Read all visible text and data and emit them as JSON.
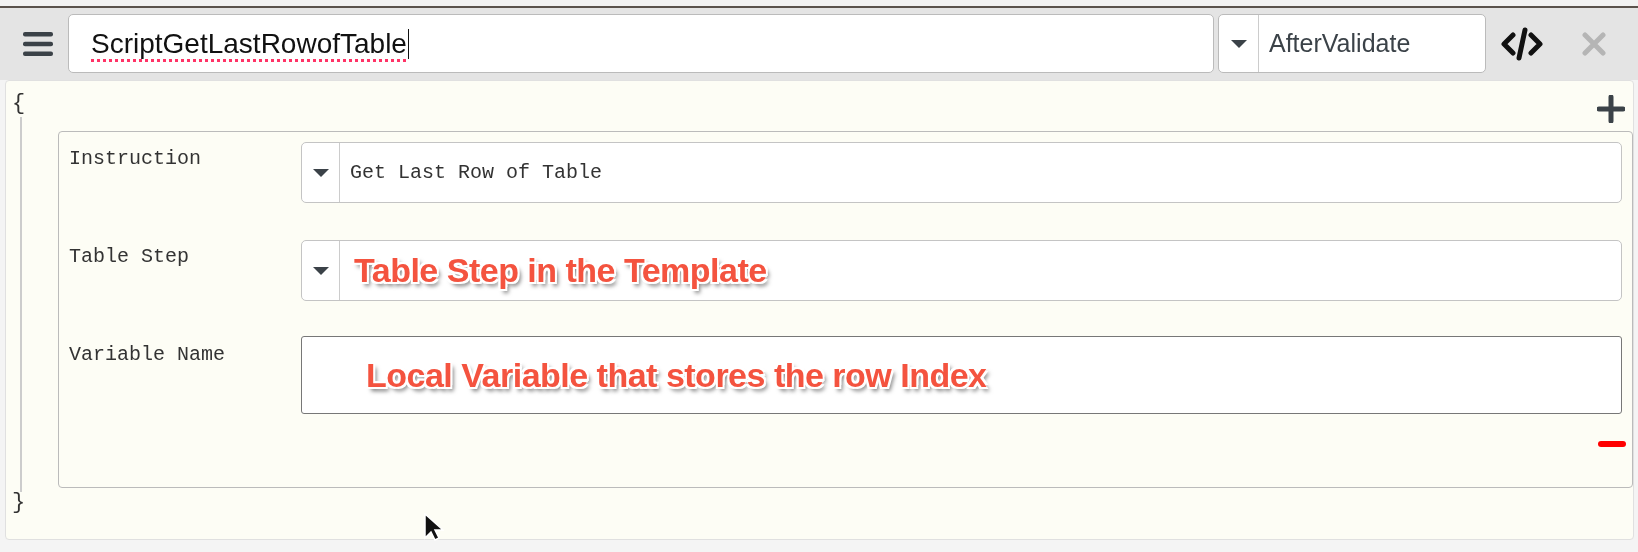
{
  "toolbar": {
    "script_name": "ScriptGetLastRowofTable",
    "misspelled": true,
    "event": "AfterValidate",
    "close_disabled": true
  },
  "editor": {
    "open_brace": "{",
    "close_brace": "}",
    "instruction_block": {
      "fields": [
        {
          "label": "Instruction",
          "kind": "select",
          "value": "Get Last Row of Table"
        },
        {
          "label": "Table Step",
          "kind": "select",
          "annotation": "Table Step in the Template"
        },
        {
          "label": "Variable Name",
          "kind": "input",
          "annotation": "Local Variable that stores the row Index"
        }
      ]
    }
  }
}
